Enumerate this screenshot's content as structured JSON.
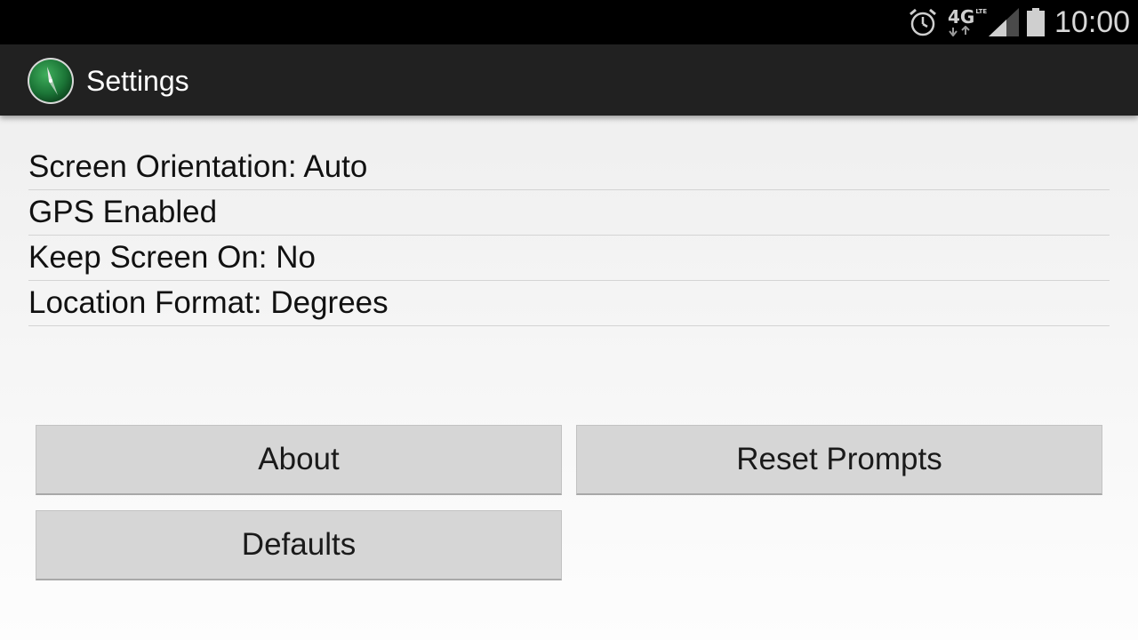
{
  "status_bar": {
    "network_label": "4G",
    "network_sub": "LTE",
    "time": "10:00",
    "icons": [
      "alarm-icon",
      "network-4g-lte-icon",
      "signal-strength-icon",
      "battery-icon"
    ]
  },
  "action_bar": {
    "app_icon": "compass-icon",
    "title": "Settings"
  },
  "settings": {
    "items": [
      {
        "label": "Screen Orientation: Auto"
      },
      {
        "label": "GPS Enabled"
      },
      {
        "label": "Keep Screen On: No"
      },
      {
        "label": "Location Format: Degrees"
      }
    ]
  },
  "buttons": {
    "about": "About",
    "reset_prompts": "Reset Prompts",
    "defaults": "Defaults"
  },
  "colors": {
    "status_bar": "#000000",
    "action_bar": "#212121",
    "app_icon_green": "#1f7a3a",
    "button": "#d6d6d6"
  }
}
